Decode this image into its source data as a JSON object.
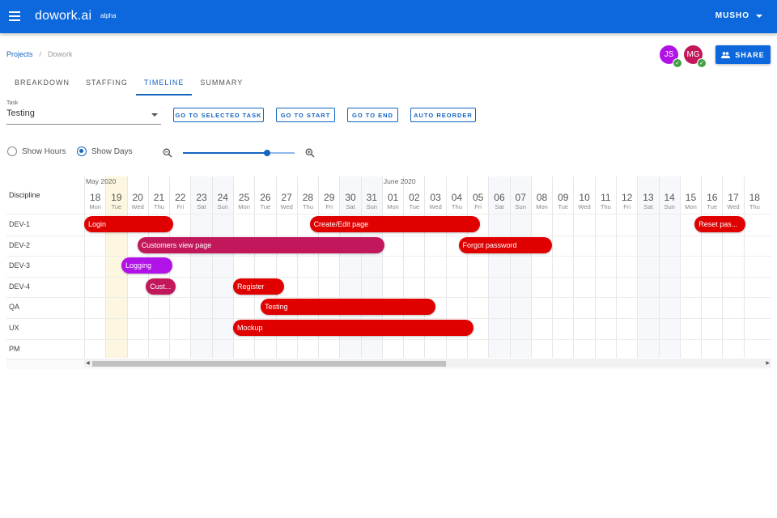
{
  "appbar": {
    "logo": "dowork.ai",
    "badge": "alpha",
    "user": "MUSHO"
  },
  "breadcrumb": {
    "root": "Projects",
    "sep": "/",
    "current": "Dowork"
  },
  "collaborators": [
    {
      "initials": "JS",
      "color": "#b112e8"
    },
    {
      "initials": "MG",
      "color": "#c2185b"
    }
  ],
  "share_label": "SHARE",
  "tabs": [
    "BREAKDOWN",
    "STAFFING",
    "TIMELINE",
    "SUMMARY"
  ],
  "active_tab": "TIMELINE",
  "task": {
    "label": "Task",
    "value": "Testing"
  },
  "toolbar": {
    "go_selected": "GO TO SELECTED TASK",
    "go_start": "GO TO START",
    "go_end": "GO TO END",
    "auto_reorder": "AUTO REORDER"
  },
  "view_mode": {
    "hours": "Show Hours",
    "days": "Show Days",
    "selected": "days"
  },
  "zoom_level": 0.75,
  "timeline": {
    "discipline_header": "Discipline",
    "months": [
      {
        "label": "May 2020",
        "day_index": 0
      },
      {
        "label": "June 2020",
        "day_index": 14
      }
    ],
    "days": [
      {
        "num": "18",
        "name": "Mon"
      },
      {
        "num": "19",
        "name": "Tue"
      },
      {
        "num": "20",
        "name": "Wed"
      },
      {
        "num": "21",
        "name": "Thu"
      },
      {
        "num": "22",
        "name": "Fri"
      },
      {
        "num": "23",
        "name": "Sat"
      },
      {
        "num": "24",
        "name": "Sun"
      },
      {
        "num": "25",
        "name": "Mon"
      },
      {
        "num": "26",
        "name": "Tue"
      },
      {
        "num": "27",
        "name": "Wed"
      },
      {
        "num": "28",
        "name": "Thu"
      },
      {
        "num": "29",
        "name": "Fri"
      },
      {
        "num": "30",
        "name": "Sat"
      },
      {
        "num": "31",
        "name": "Sun"
      },
      {
        "num": "01",
        "name": "Mon"
      },
      {
        "num": "02",
        "name": "Tue"
      },
      {
        "num": "03",
        "name": "Wed"
      },
      {
        "num": "04",
        "name": "Thu"
      },
      {
        "num": "05",
        "name": "Fri"
      },
      {
        "num": "06",
        "name": "Sat"
      },
      {
        "num": "07",
        "name": "Sun"
      },
      {
        "num": "08",
        "name": "Mon"
      },
      {
        "num": "09",
        "name": "Tue"
      },
      {
        "num": "10",
        "name": "Wed"
      },
      {
        "num": "11",
        "name": "Thu"
      },
      {
        "num": "12",
        "name": "Fri"
      },
      {
        "num": "13",
        "name": "Sat"
      },
      {
        "num": "14",
        "name": "Sun"
      },
      {
        "num": "15",
        "name": "Mon"
      },
      {
        "num": "16",
        "name": "Tue"
      },
      {
        "num": "17",
        "name": "Wed"
      },
      {
        "num": "18",
        "name": "Thu"
      }
    ],
    "highlighted_day_index": 1,
    "rows": [
      "DEV-1",
      "DEV-2",
      "DEV-3",
      "DEV-4",
      "QA",
      "UX",
      "PM"
    ],
    "tasks": [
      {
        "label": "Login",
        "row": 0,
        "start": 0.0,
        "duration": 4.2,
        "color": "#e00000"
      },
      {
        "label": "Create/Edit page",
        "row": 0,
        "start": 10.6,
        "duration": 8.0,
        "color": "#e00000"
      },
      {
        "label": "Reset pas...",
        "row": 0,
        "start": 28.7,
        "duration": 2.4,
        "color": "#e00000"
      },
      {
        "label": "Customers view page",
        "row": 1,
        "start": 2.5,
        "duration": 11.6,
        "color": "#c2185b"
      },
      {
        "label": "Forgot password",
        "row": 1,
        "start": 17.6,
        "duration": 4.4,
        "color": "#e00000"
      },
      {
        "label": "Logging",
        "row": 2,
        "start": 1.75,
        "duration": 2.4,
        "color": "#b112e8"
      },
      {
        "label": "Cust...",
        "row": 3,
        "start": 2.9,
        "duration": 1.4,
        "color": "#c2185b"
      },
      {
        "label": "Register",
        "row": 3,
        "start": 7.0,
        "duration": 2.4,
        "color": "#e00000"
      },
      {
        "label": "Testing",
        "row": 4,
        "start": 8.3,
        "duration": 8.2,
        "color": "#e00000"
      },
      {
        "label": "Mockup",
        "row": 5,
        "start": 7.0,
        "duration": 11.3,
        "color": "#e00000"
      }
    ]
  }
}
